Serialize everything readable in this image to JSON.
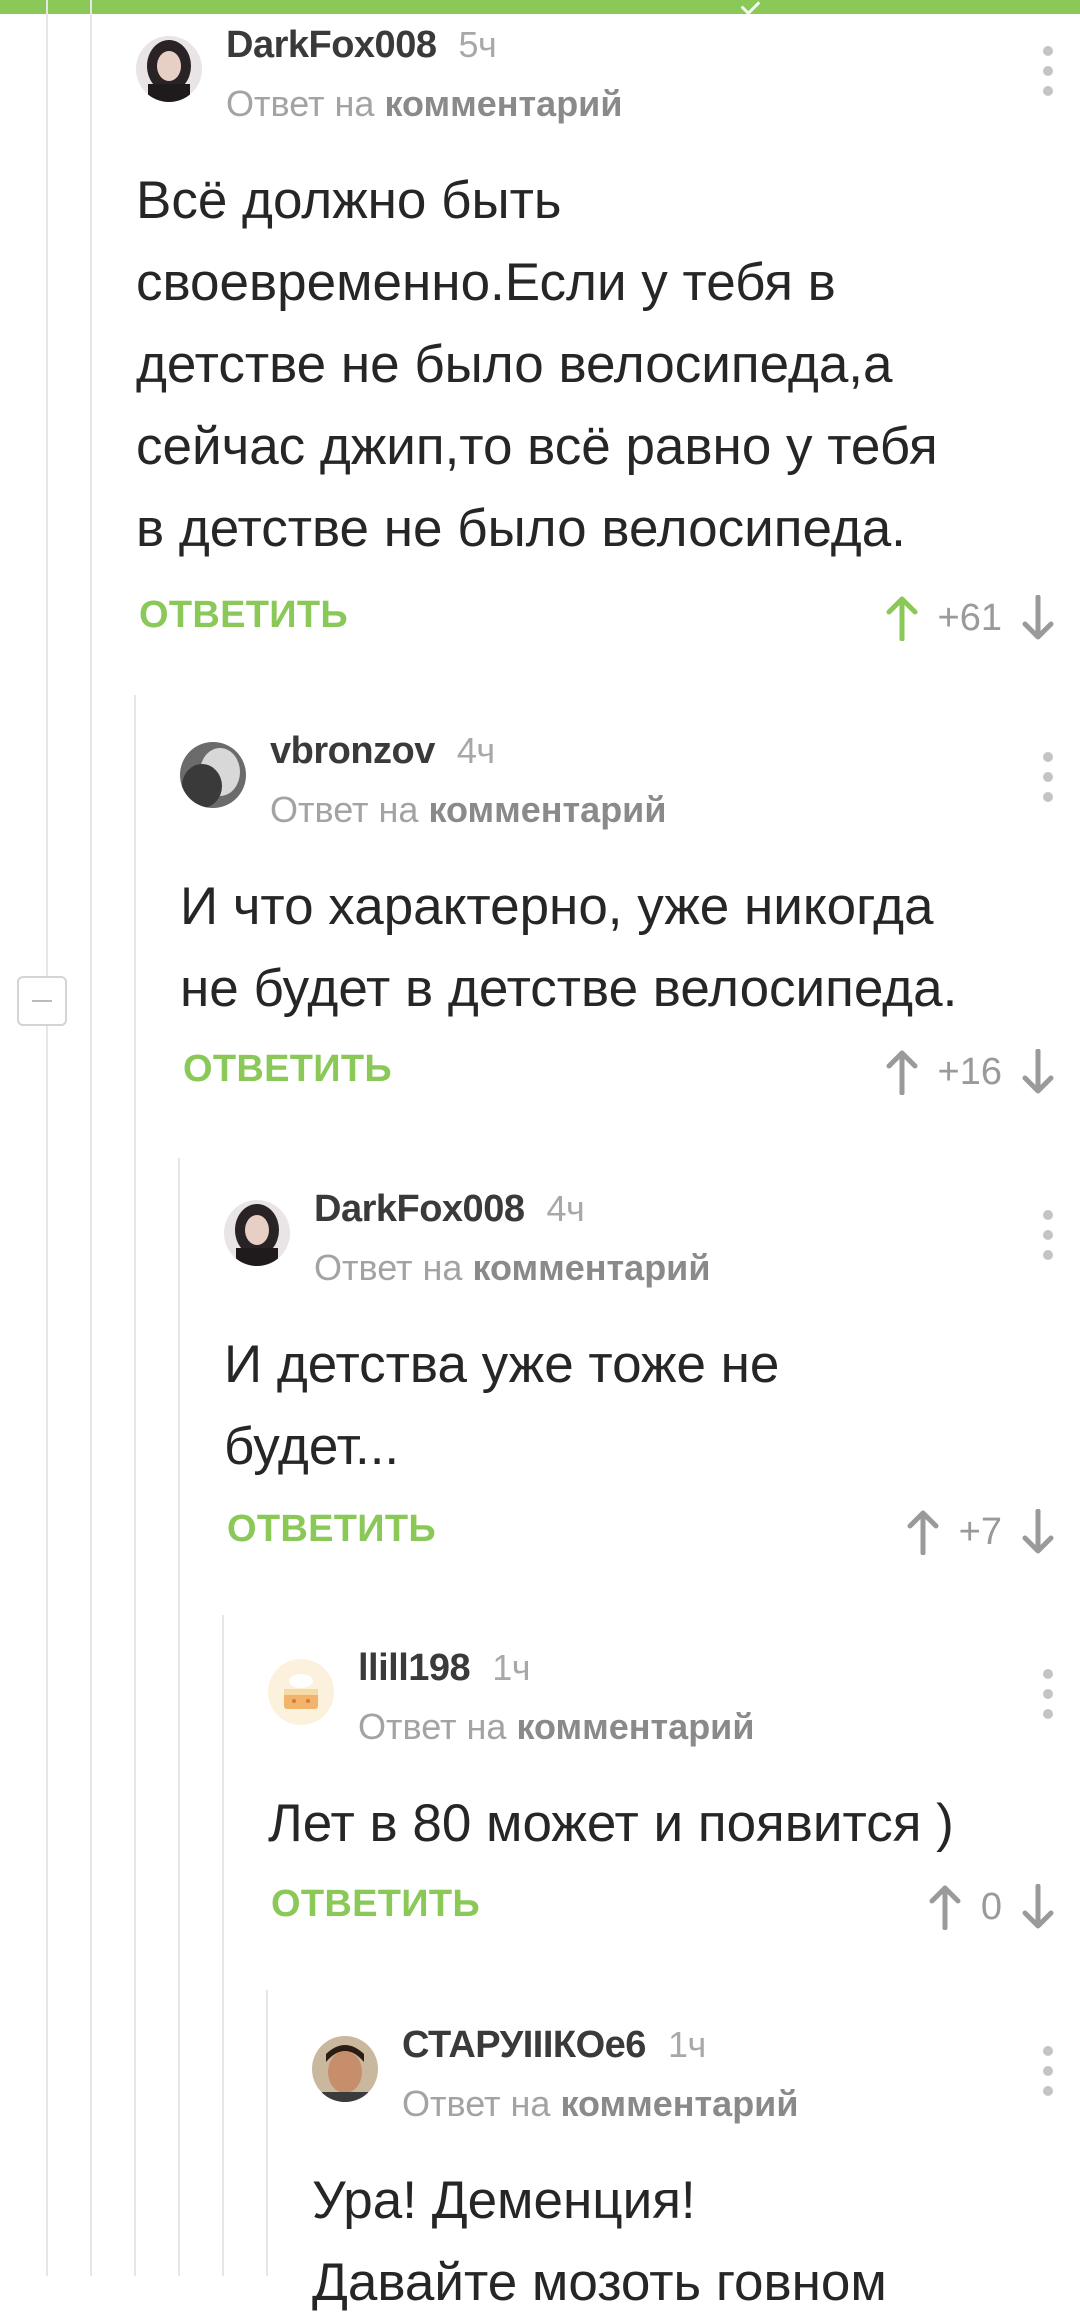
{
  "colors": {
    "accent": "#8ac858",
    "text": "#262626",
    "muted": "#a3a3a3",
    "vote_up_active": "#8ac858",
    "vote_neutral": "#9a9a9a"
  },
  "reply_prefix": "Ответ на",
  "reply_link": "комментарий",
  "reply_button_label": "ОТВЕТИТЬ",
  "comments": [
    {
      "author": "DarkFox008",
      "time": "5ч",
      "text": "Всё должно быть\nсвоевременно.Если у тебя в\nдетстве не было велосипеда,а\nсейчас джип,то всё равно у тебя\nв детстве не было велосипеда.",
      "score": "+61",
      "upvoted": true,
      "avatar_icon": "user-avatar-dark-hair"
    },
    {
      "author": "vbronzov",
      "time": "4ч",
      "text": "И что характерно, уже никогда\nне будет в детстве велосипеда.",
      "score": "+16",
      "upvoted": false,
      "avatar_icon": "user-avatar-grey"
    },
    {
      "author": "DarkFox008",
      "time": "4ч",
      "text": "И детства уже тоже не\nбудет...",
      "score": "+7",
      "upvoted": false,
      "avatar_icon": "user-avatar-dark-hair"
    },
    {
      "author": "llill198",
      "time": "1ч",
      "text": "Лет в 80 может и появится )",
      "score": "0",
      "upvoted": false,
      "avatar_icon": "user-avatar-cake"
    },
    {
      "author": "СТАРУIIIКОе6",
      "time": "1ч",
      "text": "Ура! Деменция!\nДавайте мозоть говном",
      "score": "",
      "upvoted": false,
      "avatar_icon": "user-avatar-man"
    }
  ]
}
